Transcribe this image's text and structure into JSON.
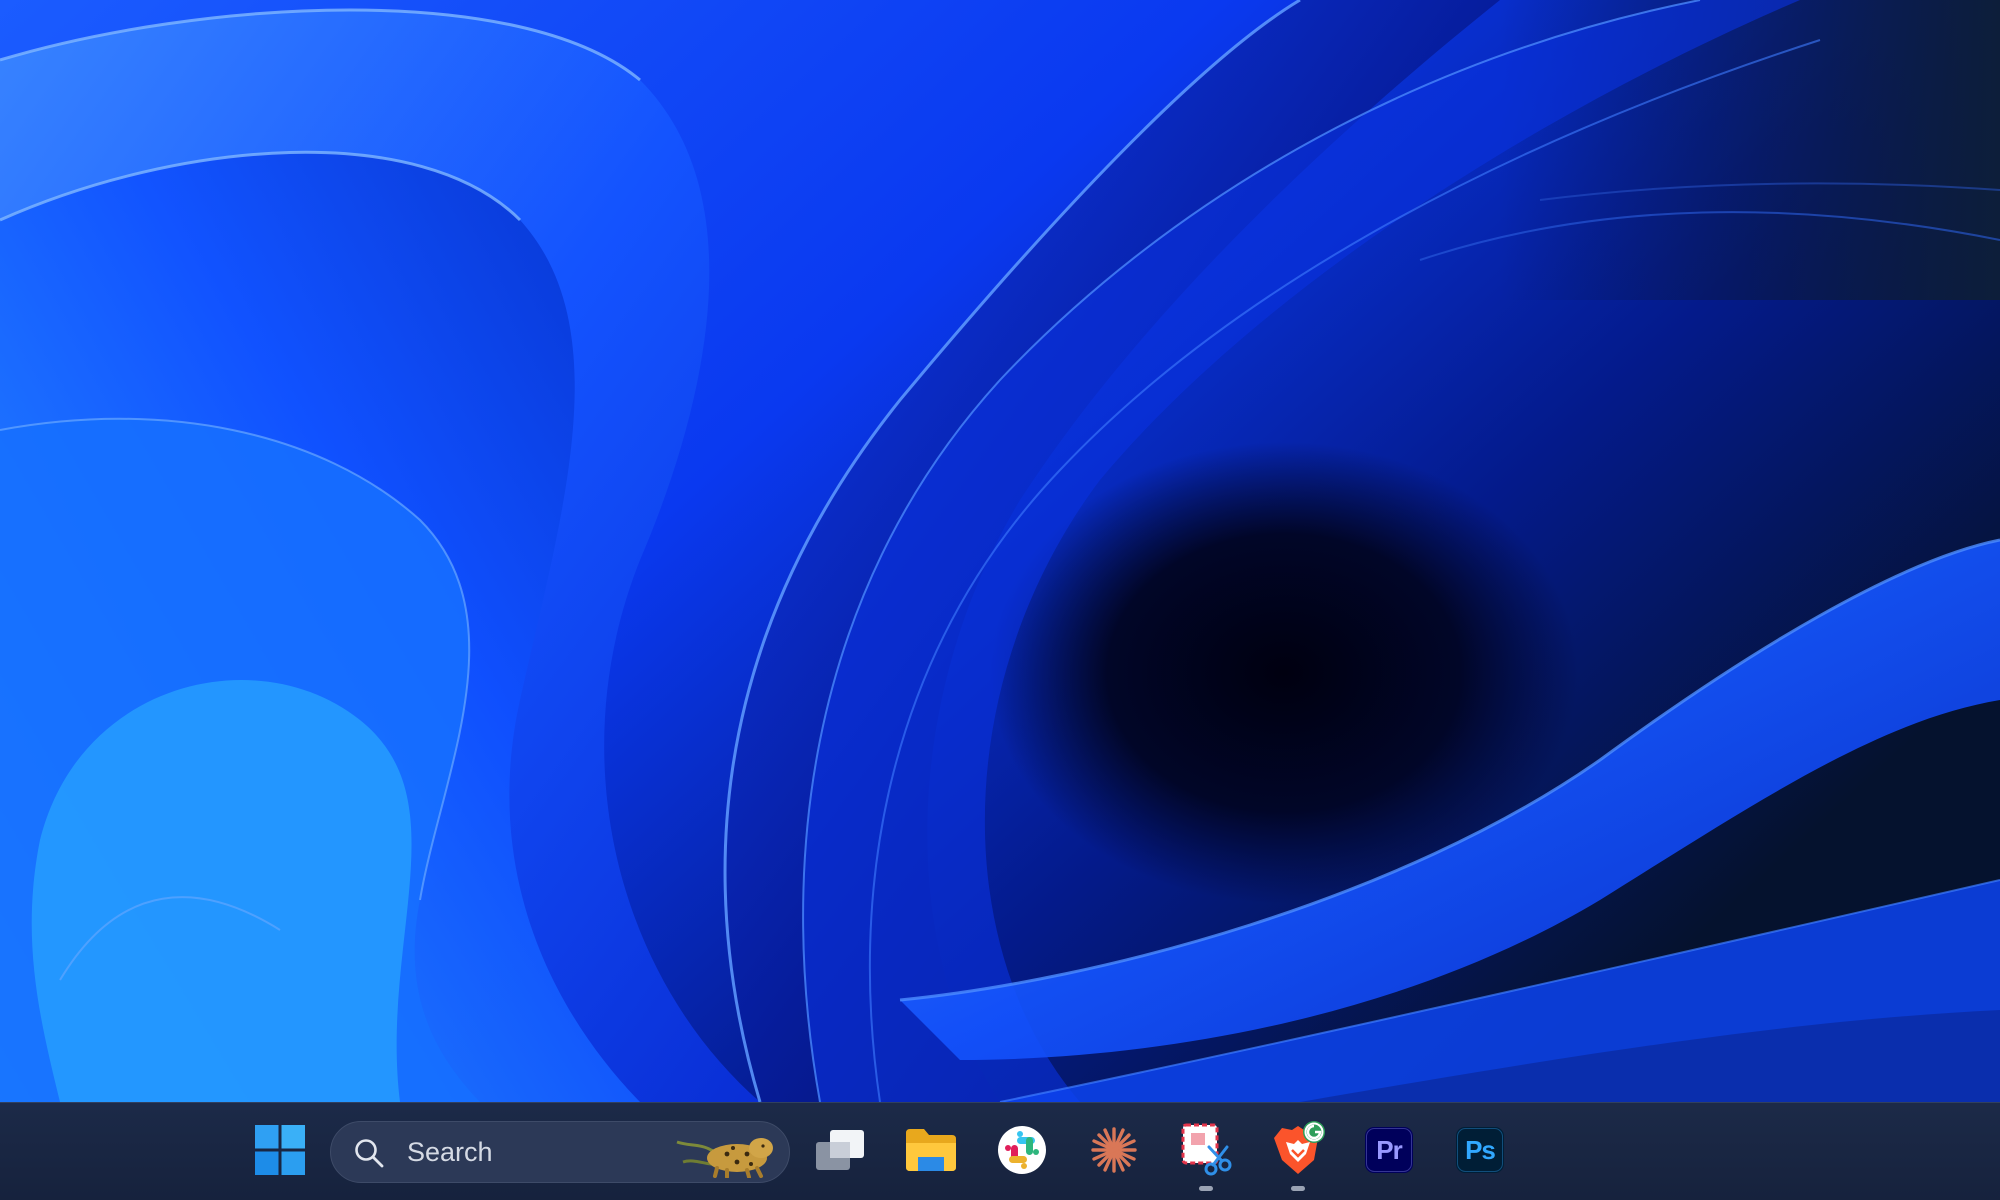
{
  "screen": {
    "wallpaper": "windows-11-bloom-blue",
    "colors": {
      "wallpaper_light": "#2c7bff",
      "wallpaper_mid": "#0a3dff",
      "wallpaper_dark": "#00051e",
      "taskbar": "#1a2643",
      "search_box": "#2c3957"
    }
  },
  "taskbar": {
    "start": {
      "icon": "windows-logo-icon"
    },
    "search": {
      "label": "Search",
      "icon": "search-icon",
      "highlight_icon": "search-highlight-leopard-icon"
    },
    "apps": [
      {
        "name": "task-view",
        "icon": "task-view-icon",
        "running": false
      },
      {
        "name": "file-explorer",
        "icon": "folder-icon",
        "running": false
      },
      {
        "name": "slack",
        "icon": "slack-icon",
        "running": false
      },
      {
        "name": "claude",
        "icon": "asterisk-burst-icon",
        "running": false
      },
      {
        "name": "snipping-tool",
        "icon": "snipping-tool-icon",
        "running": true
      },
      {
        "name": "brave",
        "icon": "brave-lion-icon",
        "running": true
      },
      {
        "name": "premiere-pro",
        "icon": "premiere-pro-icon",
        "label": "Pr",
        "running": false
      },
      {
        "name": "photoshop",
        "icon": "photoshop-icon",
        "label": "Ps",
        "running": false
      }
    ]
  }
}
